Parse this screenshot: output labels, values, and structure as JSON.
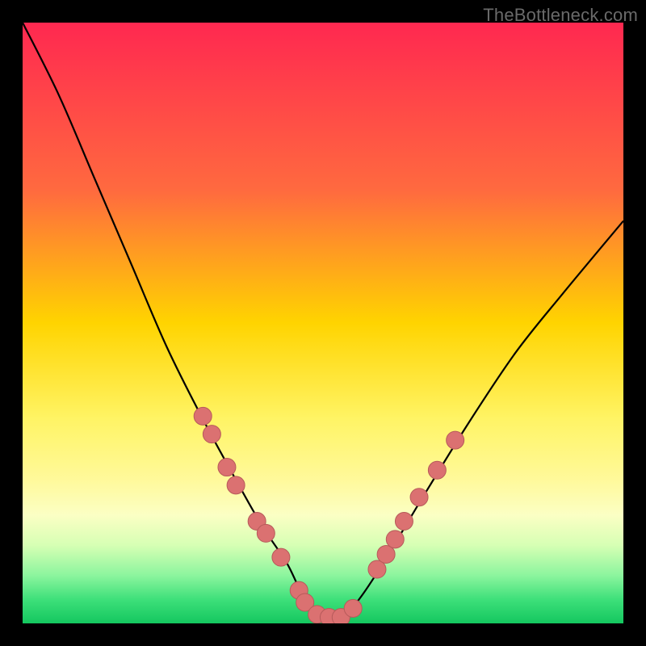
{
  "watermark": {
    "text": "TheBottleneck.com"
  },
  "chart_data": {
    "type": "line",
    "title": "",
    "xlabel": "",
    "ylabel": "",
    "xlim": [
      0,
      100
    ],
    "ylim": [
      0,
      100
    ],
    "grid": false,
    "legend": false,
    "background_gradient_stops": [
      {
        "offset": 0,
        "color": "#ff2850"
      },
      {
        "offset": 28,
        "color": "#ff6a3f"
      },
      {
        "offset": 50,
        "color": "#ffd400"
      },
      {
        "offset": 66,
        "color": "#fff465"
      },
      {
        "offset": 76,
        "color": "#fff99a"
      },
      {
        "offset": 82,
        "color": "#fbffc4"
      },
      {
        "offset": 87,
        "color": "#d6ffb4"
      },
      {
        "offset": 92,
        "color": "#8cf59e"
      },
      {
        "offset": 96,
        "color": "#3ee07a"
      },
      {
        "offset": 100,
        "color": "#14c75f"
      }
    ],
    "series": [
      {
        "name": "bottleneck-curve",
        "x": [
          0,
          6,
          12,
          18,
          24,
          30,
          36,
          40,
          44,
          47,
          50,
          53,
          56,
          60,
          66,
          74,
          82,
          90,
          100
        ],
        "y": [
          100,
          88,
          74,
          60,
          46,
          34,
          23,
          16,
          10,
          4,
          1,
          1,
          4,
          10,
          20,
          33,
          45,
          55,
          67
        ]
      }
    ],
    "markers": [
      {
        "x": 30.0,
        "y": 34.5
      },
      {
        "x": 31.5,
        "y": 31.5
      },
      {
        "x": 34.0,
        "y": 26.0
      },
      {
        "x": 35.5,
        "y": 23.0
      },
      {
        "x": 39.0,
        "y": 17.0
      },
      {
        "x": 40.5,
        "y": 15.0
      },
      {
        "x": 43.0,
        "y": 11.0
      },
      {
        "x": 46.0,
        "y": 5.5
      },
      {
        "x": 47.0,
        "y": 3.5
      },
      {
        "x": 49.0,
        "y": 1.5
      },
      {
        "x": 51.0,
        "y": 1.0
      },
      {
        "x": 53.0,
        "y": 1.0
      },
      {
        "x": 55.0,
        "y": 2.5
      },
      {
        "x": 59.0,
        "y": 9.0
      },
      {
        "x": 60.5,
        "y": 11.5
      },
      {
        "x": 62.0,
        "y": 14.0
      },
      {
        "x": 63.5,
        "y": 17.0
      },
      {
        "x": 66.0,
        "y": 21.0
      },
      {
        "x": 69.0,
        "y": 25.5
      },
      {
        "x": 72.0,
        "y": 30.5
      }
    ],
    "marker_style": {
      "radius": 11,
      "fill": "#db7171",
      "stroke": "#b75a5a"
    }
  }
}
